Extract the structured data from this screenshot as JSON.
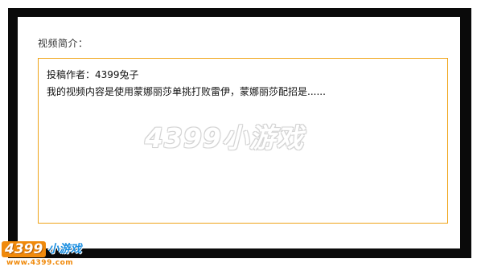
{
  "video_intro": {
    "section_title": "视频简介：",
    "author_line": "投稿作者：4399兔子",
    "content_line": "我的视频内容是使用蒙娜丽莎单挑打败雷伊，蒙娜丽莎配招是......"
  },
  "watermark": {
    "center_text": "4399小游戏"
  },
  "logo": {
    "number": "4399",
    "chinese": "小游戏",
    "url": "www.4399.com"
  },
  "colors": {
    "frame_border": "#0a0a0a",
    "box_border": "#f0a418",
    "logo_orange": "#f08a0c",
    "logo_blue": "#1d8fe0"
  }
}
